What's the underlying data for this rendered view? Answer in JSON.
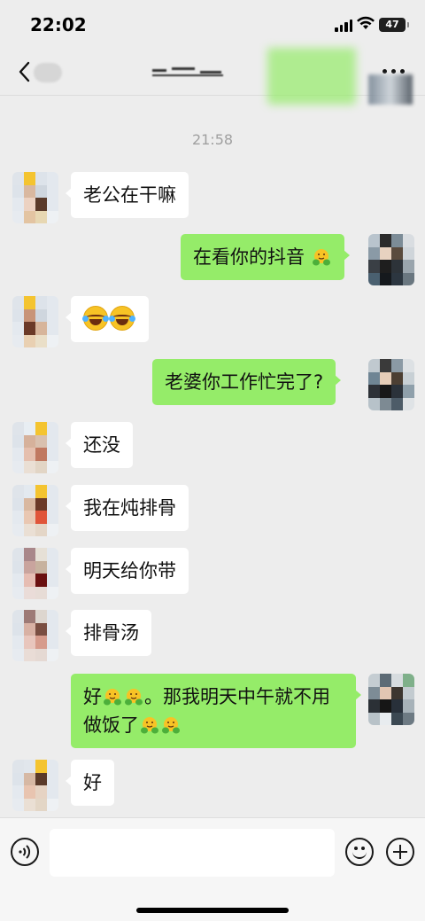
{
  "status_bar": {
    "time": "22:02",
    "battery": "47"
  },
  "nav": {
    "title": "",
    "unread_badge": ""
  },
  "chat": {
    "timestamp": "21:58",
    "messages": [
      {
        "side": "left",
        "text": "老公在干嘛"
      },
      {
        "side": "right",
        "text": "在看你的抖音",
        "emoji": "hugging-emoji"
      },
      {
        "side": "left",
        "text": "",
        "emoji": "laughing-crying-emoji x2"
      },
      {
        "side": "right",
        "text": "老婆你工作忙完了?"
      },
      {
        "side": "left",
        "text": "还没"
      },
      {
        "side": "left",
        "text": "我在炖排骨"
      },
      {
        "side": "left",
        "text": "明天给你带"
      },
      {
        "side": "left",
        "text": "排骨汤"
      },
      {
        "side": "right",
        "text_part1": "好",
        "text_part2": "。那我明天中午就不用做饭了"
      },
      {
        "side": "left",
        "text": "好"
      }
    ]
  },
  "input_bar": {
    "value": "",
    "placeholder": ""
  },
  "colors": {
    "background": "#ededed",
    "sent_bubble": "#95ec69",
    "received_bubble": "#ffffff"
  }
}
